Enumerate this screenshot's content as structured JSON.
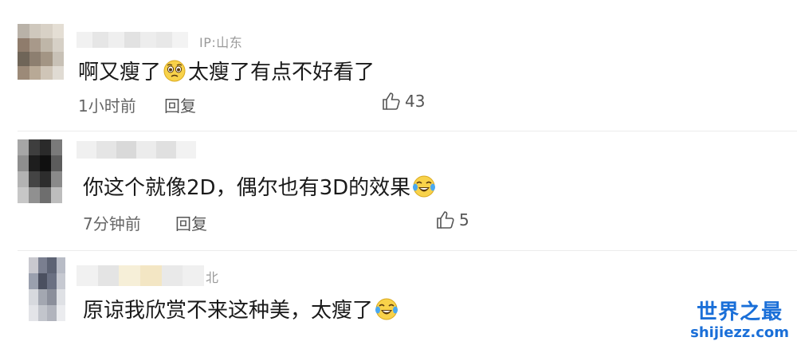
{
  "comments": [
    {
      "ip": "IP:山东",
      "text_before": "啊又瘦了",
      "emoji_1": "pleading-face-icon",
      "text_after": "太瘦了有点不好看了",
      "time": "1小时前",
      "reply": "回复",
      "likes": "43"
    },
    {
      "ip": "",
      "text_before": "你这个就像2D，偶尔也有3D的效果",
      "emoji_1": "tears-of-joy-icon",
      "text_after": "",
      "time": "7分钟前",
      "reply": "回复",
      "likes": "5"
    },
    {
      "ip": "北",
      "text_before": "原谅我欣赏不来这种美，太瘦了",
      "emoji_1": "tears-of-joy-icon",
      "text_after": "",
      "time": "",
      "reply": "",
      "likes": ""
    }
  ],
  "watermark": {
    "title": "世界之最",
    "url": "shijiezz.com"
  },
  "colors": {
    "text": "#1a1a1a",
    "meta": "#666666",
    "ip": "#9a9a9a",
    "watermark": "#1a6fd8"
  }
}
